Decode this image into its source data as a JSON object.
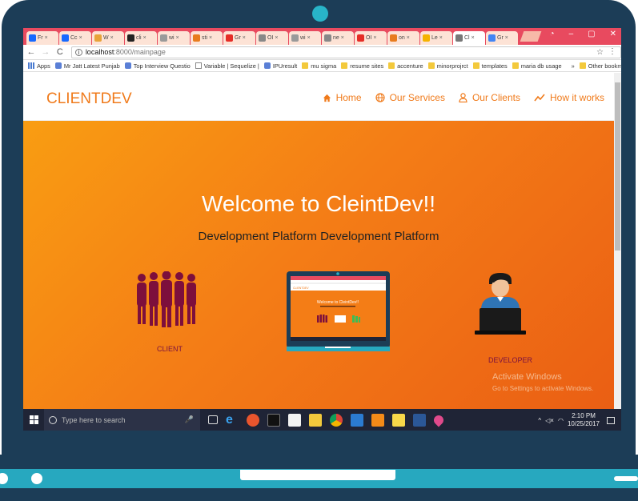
{
  "browser": {
    "tabs": [
      {
        "label": "Fr",
        "icon": "behance-icon",
        "color": "#1769ff"
      },
      {
        "label": "Cc",
        "icon": "behance-icon",
        "color": "#1769ff"
      },
      {
        "label": "W",
        "icon": "bookmark-icon",
        "color": "#e8a33a"
      },
      {
        "label": "cli",
        "icon": "github-icon",
        "color": "#222222"
      },
      {
        "label": "wi",
        "icon": "video-icon",
        "color": "#9a9a9a"
      },
      {
        "label": "sti",
        "icon": "stackoverflow-icon",
        "color": "#e87c1e"
      },
      {
        "label": "Gr",
        "icon": "youtube-icon",
        "color": "#e52d27"
      },
      {
        "label": "OI",
        "icon": "window-icon",
        "color": "#888888"
      },
      {
        "label": "wi",
        "icon": "video-icon",
        "color": "#9a9a9a"
      },
      {
        "label": "ne",
        "icon": "shield-icon",
        "color": "#888888"
      },
      {
        "label": "OI",
        "icon": "youtube-icon",
        "color": "#e52d27"
      },
      {
        "label": "on",
        "icon": "stackoverflow-icon",
        "color": "#e87c1e"
      },
      {
        "label": "Le",
        "icon": "bolt-icon",
        "color": "#f5b301"
      },
      {
        "label": "Cl",
        "icon": "document-icon",
        "color": "#777777",
        "active": true
      },
      {
        "label": "Gr",
        "icon": "google-icon",
        "color": "#4285f4"
      }
    ],
    "url_host": "localhost",
    "url_path": ":8000/mainpage",
    "window_controls": [
      "◔",
      "–",
      "▢",
      "✕"
    ],
    "bookmarks": [
      {
        "label": "Apps",
        "icon": "apps-icon"
      },
      {
        "label": "Mr Jatt Latest Punjab",
        "icon": "site-icon"
      },
      {
        "label": "Top Interview Questio",
        "icon": "site-icon"
      },
      {
        "label": "Variable | Sequelize |",
        "icon": "document-icon"
      },
      {
        "label": "IPUresult",
        "icon": "site-icon"
      },
      {
        "label": "mu sigma",
        "icon": "folder-icon"
      },
      {
        "label": "resume sites",
        "icon": "folder-icon"
      },
      {
        "label": "accenture",
        "icon": "folder-icon"
      },
      {
        "label": "minorprojrct",
        "icon": "folder-icon"
      },
      {
        "label": "templates",
        "icon": "folder-icon"
      },
      {
        "label": "maria db usage",
        "icon": "folder-icon"
      },
      {
        "label": "»",
        "icon": ""
      },
      {
        "label": "Other bookmarks",
        "icon": "folder-icon"
      }
    ]
  },
  "site": {
    "brand": "CLIENTDEV",
    "nav": [
      {
        "label": "Home",
        "icon": "home-icon"
      },
      {
        "label": "Our Services",
        "icon": "globe-icon"
      },
      {
        "label": "Our Clients",
        "icon": "user-icon"
      },
      {
        "label": "How it works",
        "icon": "trend-icon"
      }
    ],
    "hero_title": "Welcome to CleintDev!!",
    "hero_subtitle": "Development Platform Development Platform",
    "client_label": "CLIENT",
    "developer_label": "DEVELOPER",
    "mini_screen_title": "Welcome to CleintDev!!",
    "accent_color": "#f07a1a"
  },
  "watermark": {
    "line1": "Activate Windows",
    "line2": "Go to Settings to activate Windows."
  },
  "taskbar": {
    "search_placeholder": "Type here to search",
    "time": "2:10 PM",
    "date": "10/25/2017"
  }
}
